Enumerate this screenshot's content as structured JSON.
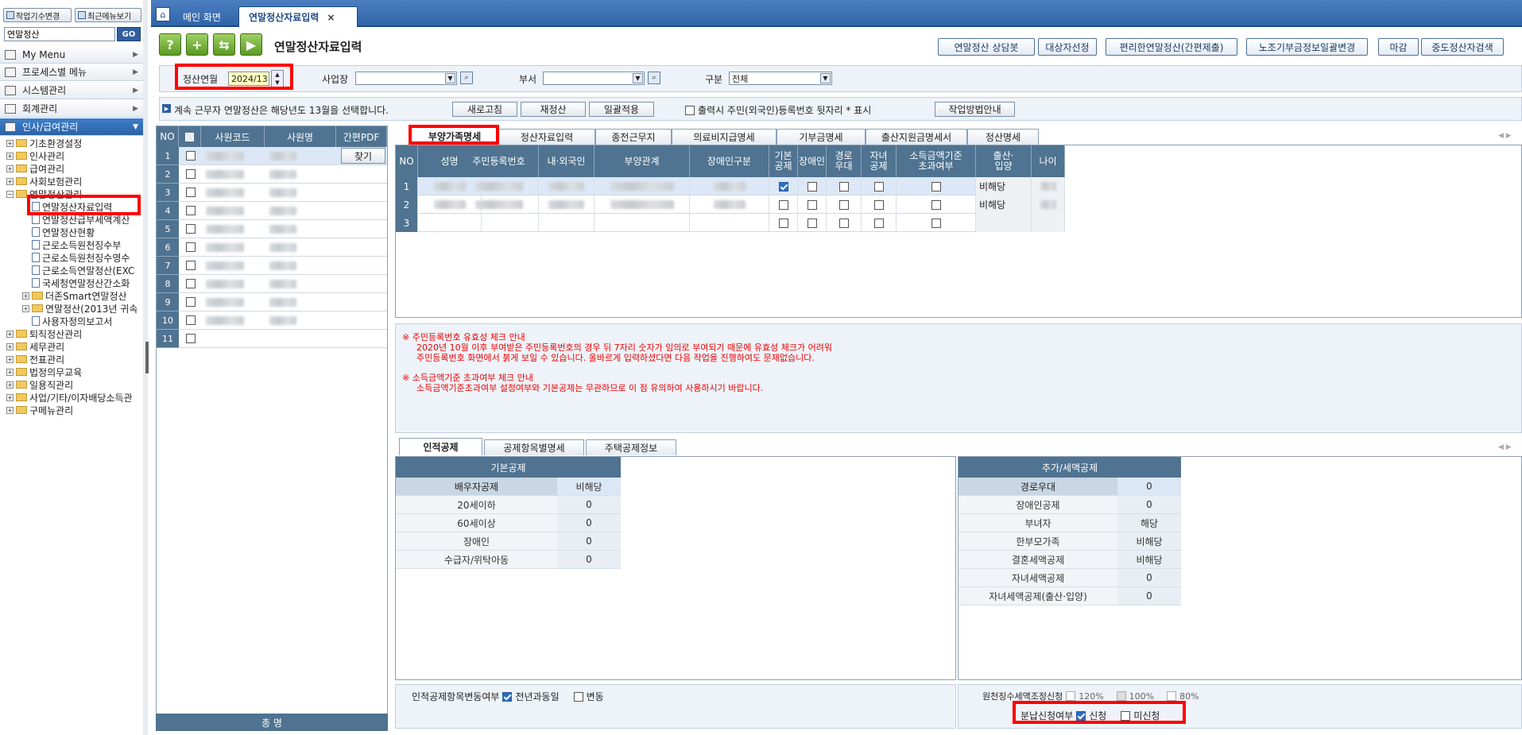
{
  "sidebar": {
    "btn_work": "작업기수변경",
    "btn_recent": "최근메뉴보기",
    "search_value": "연말정산",
    "go": "GO",
    "menus": [
      "My Menu",
      "프로세스별 메뉴",
      "시스템관리",
      "회계관리",
      "인사/급여관리"
    ],
    "tree": [
      {
        "label": "기초환경설정",
        "type": "folder",
        "lvl": 0,
        "pm": "+"
      },
      {
        "label": "인사관리",
        "type": "folder",
        "lvl": 0,
        "pm": "+"
      },
      {
        "label": "급여관리",
        "type": "folder",
        "lvl": 0,
        "pm": "+"
      },
      {
        "label": "사회보험관리",
        "type": "folder",
        "lvl": 0,
        "pm": "+"
      },
      {
        "label": "연말정산관리",
        "type": "folder",
        "lvl": 0,
        "pm": "−"
      },
      {
        "label": "연말정산자료입력",
        "type": "doc",
        "lvl": 1
      },
      {
        "label": "연말정산급부세액계산",
        "type": "doc",
        "lvl": 1
      },
      {
        "label": "연말정산현황",
        "type": "doc",
        "lvl": 1
      },
      {
        "label": "근로소득원천징수부",
        "type": "doc",
        "lvl": 1
      },
      {
        "label": "근로소득원천징수영수",
        "type": "doc",
        "lvl": 1
      },
      {
        "label": "근로소득연말정산(EXC",
        "type": "doc",
        "lvl": 1
      },
      {
        "label": "국세청연말정산간소화",
        "type": "doc",
        "lvl": 1
      },
      {
        "label": "더존Smart연말정산",
        "type": "folder",
        "lvl": 1,
        "pm": "+"
      },
      {
        "label": "연말정산(2013년 귀속",
        "type": "folder",
        "lvl": 1,
        "pm": "+"
      },
      {
        "label": "사용자정의보고서",
        "type": "doc",
        "lvl": 1
      },
      {
        "label": "퇴직정산관리",
        "type": "folder",
        "lvl": 0,
        "pm": "+"
      },
      {
        "label": "세무관리",
        "type": "folder",
        "lvl": 0,
        "pm": "+"
      },
      {
        "label": "전표관리",
        "type": "folder",
        "lvl": 0,
        "pm": "+"
      },
      {
        "label": "법정의무교육",
        "type": "folder",
        "lvl": 0,
        "pm": "+"
      },
      {
        "label": "일용직관리",
        "type": "folder",
        "lvl": 0,
        "pm": "+"
      },
      {
        "label": "사업/기타/이자배당소득관",
        "type": "folder",
        "lvl": 0,
        "pm": "+"
      },
      {
        "label": "구메뉴관리",
        "type": "folder",
        "lvl": 0,
        "pm": "+"
      }
    ]
  },
  "tabs": {
    "home": "메인 화면",
    "active": "연말정산자료입력",
    "close": "×"
  },
  "page_title": "연말정산자료입력",
  "toolbar": {
    "help": "?",
    "add": "+",
    "b3": "⇆",
    "b4": "▶"
  },
  "right_buttons": [
    "연말정산 상담봇",
    "대상자선정",
    "편리한연말정산(간편제출)",
    "노조기부금정보일괄변경",
    "마감",
    "중도정산자검색"
  ],
  "filter": {
    "year_label": "정산연월",
    "year_value": "2024/13",
    "site_label": "사업장",
    "dept_label": "부서",
    "type_label": "구분",
    "type_value": "전체"
  },
  "info": {
    "text": "계속 근무자 연말정산은 해당년도 13월을 선택합니다.",
    "btn_refresh": "새로고침",
    "btn_recalc": "재정산",
    "btn_apply": "일괄적용",
    "print_chk": "출력시 주민(외국인)등록번호 뒷자리 * 표시",
    "btn_guide": "작업방법안내"
  },
  "emp_grid": {
    "headers": [
      "NO",
      "",
      "사원코드",
      "사원명",
      "간편PDF"
    ],
    "rows": [
      "1",
      "2",
      "3",
      "4",
      "5",
      "6",
      "7",
      "8",
      "9",
      "10",
      "11"
    ],
    "find_btn": "찾기",
    "footer": "총 명"
  },
  "sub_tabs": [
    "부양가족명세",
    "정산자료입력",
    "종전근무지",
    "의료비지급명세",
    "기부금명세",
    "출산지원금명세서",
    "정산명세"
  ],
  "dep_grid": {
    "headers": [
      "NO",
      "성명",
      "주민등록번호",
      "내·외국인",
      "부양관계",
      "장애인구분",
      "기본\n공제",
      "장애인",
      "경로\n우대",
      "자녀\n공제",
      "소득금액기준\n초과여부",
      "출산·\n입양",
      "나이"
    ],
    "rows": [
      {
        "no": "1",
        "basic": true,
        "birth": "비해당"
      },
      {
        "no": "2",
        "basic": false,
        "birth": "비해당"
      },
      {
        "no": "3",
        "basic": false,
        "birth": ""
      }
    ]
  },
  "notice": {
    "h1": "※ 주민등록번호 유효성 체크 안내",
    "l1": "2020년 10월 이후 부여받은 주민등록번호의 경우 뒤 7자리 숫자가 임의로 부여되기 때문에 유효성 체크가 어려워",
    "l2": "주민등록번호 화면에서 붉게 보일 수 있습니다. 올바르게 입력하셨다면 다음 작업을 진행하여도 문제없습니다.",
    "h2": "※ 소득금액기준 초과여부 체크 안내",
    "l3": "소득금액기준초과여부 설정여부와 기본공제는 무관하므로 이 점 유의하여 사용하시기 바랍니다."
  },
  "bottom_tabs": [
    "인적공제",
    "공제항목별명세",
    "주택공제정보"
  ],
  "basic_deduction": {
    "title": "기본공제",
    "rows": [
      {
        "label": "배우자공제",
        "value": "비해당"
      },
      {
        "label": "20세이하",
        "value": "0"
      },
      {
        "label": "60세이상",
        "value": "0"
      },
      {
        "label": "장애인",
        "value": "0"
      },
      {
        "label": "수급자/위탁아동",
        "value": "0"
      }
    ]
  },
  "extra_deduction": {
    "title": "추가/세액공제",
    "rows": [
      {
        "label": "경로우대",
        "value": "0"
      },
      {
        "label": "장애인공제",
        "value": "0"
      },
      {
        "label": "부녀자",
        "value": "해당"
      },
      {
        "label": "한부모가족",
        "value": "비해당"
      },
      {
        "label": "결혼세액공제",
        "value": "비해당"
      },
      {
        "label": "자녀세액공제",
        "value": "0"
      },
      {
        "label": "자녀세액공제(출산·입양)",
        "value": "0"
      }
    ]
  },
  "bottom_left": {
    "label": "인적공제항목변동여부",
    "opt1": "전년과동일",
    "opt2": "변동"
  },
  "bottom_right": {
    "label": "원천징수세액조정신청",
    "p1": "120%",
    "p2": "100%",
    "p3": "80%",
    "split_label": "분납신청여부",
    "s1": "신청",
    "s2": "미신청"
  }
}
